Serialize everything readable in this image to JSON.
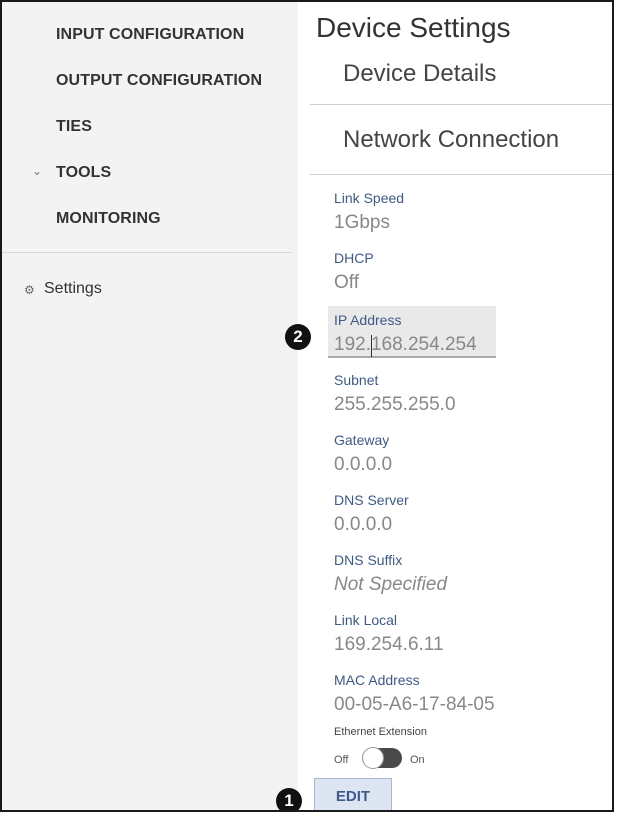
{
  "sidebar": {
    "items": [
      {
        "label": "INPUT CONFIGURATION"
      },
      {
        "label": "OUTPUT CONFIGURATION"
      },
      {
        "label": "TIES"
      },
      {
        "label": "TOOLS",
        "chevron": "⌄"
      },
      {
        "label": "MONITORING"
      }
    ],
    "settings_label": "Settings",
    "settings_icon": "⚙"
  },
  "main": {
    "page_title": "Device Settings",
    "sections": {
      "device_details": "Device Details",
      "network_connection": "Network Connection"
    },
    "fields": [
      {
        "label": "Link Speed",
        "value": "1Gbps"
      },
      {
        "label": "DHCP",
        "value": "Off"
      },
      {
        "label": "IP Address",
        "value": "192.168.254.254"
      },
      {
        "label": "Subnet",
        "value": "255.255.255.0"
      },
      {
        "label": "Gateway",
        "value": "0.0.0.0"
      },
      {
        "label": "DNS Server",
        "value": "0.0.0.0"
      },
      {
        "label": "DNS Suffix",
        "value": "Not Specified"
      },
      {
        "label": "Link Local",
        "value": "169.254.6.11"
      },
      {
        "label": "MAC Address",
        "value": "00-05-A6-17-84-05"
      }
    ],
    "ethernet_extension": {
      "label": "Ethernet Extension",
      "off_label": "Off",
      "on_label": "On",
      "state": "off"
    },
    "edit_label": "EDIT"
  },
  "callouts": {
    "one": "1",
    "two": "2"
  }
}
